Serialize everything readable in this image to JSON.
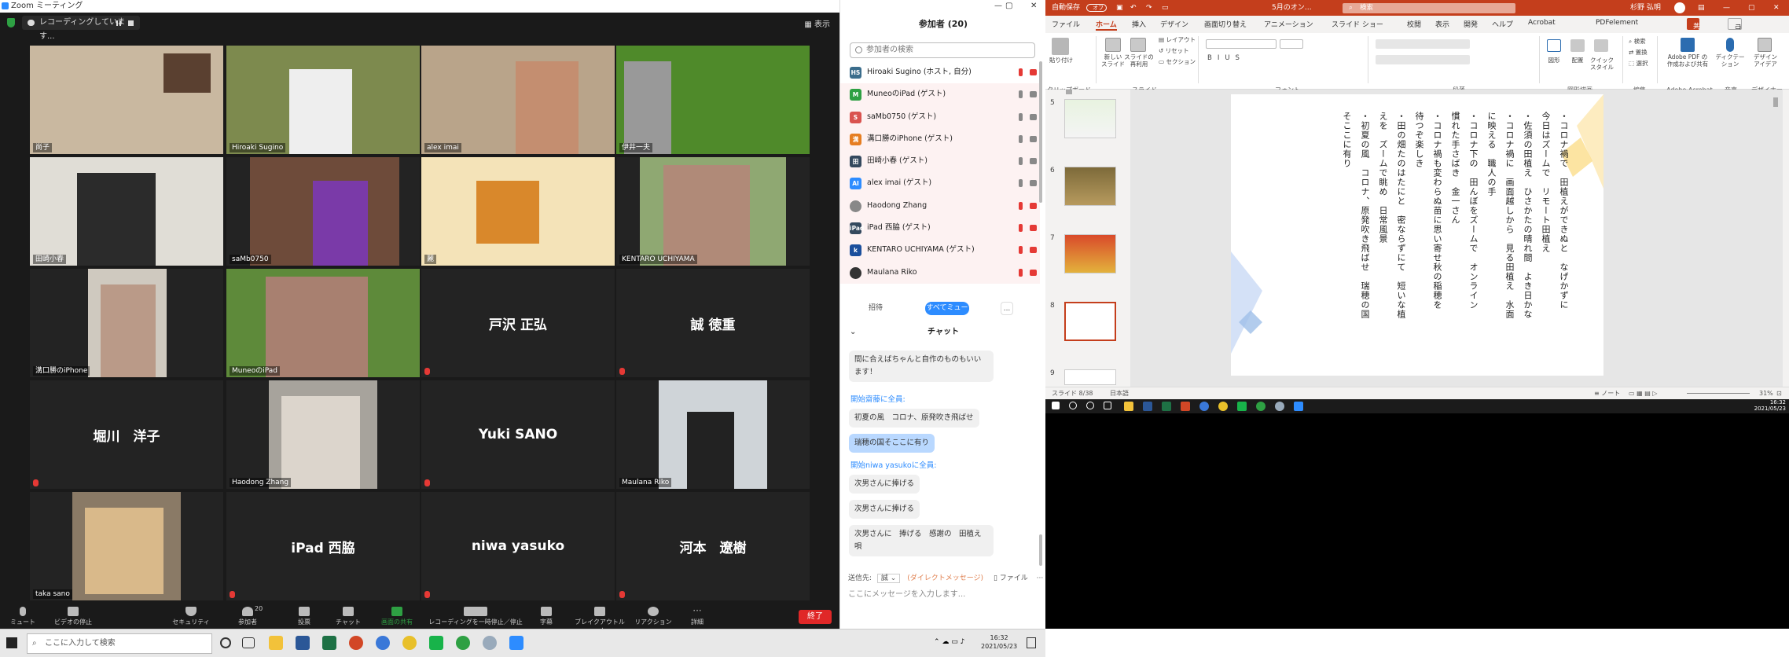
{
  "zoom": {
    "window_title": "Zoom ミーティング",
    "recording_label": "レコーディングしています...",
    "view_label": "表示",
    "tiles": [
      {
        "name": "尚子"
      },
      {
        "name": "Hiroaki Sugino"
      },
      {
        "name": "alex imai"
      },
      {
        "name": "伊井一夫"
      },
      {
        "name": "田崎小春"
      },
      {
        "name": "saMb0750"
      },
      {
        "name": "麗"
      },
      {
        "name": "KENTARO UCHIYAMA"
      },
      {
        "name": "溝口勝のiPhone"
      },
      {
        "name": "MuneoのiPad"
      },
      {
        "center": "戸沢 正弘"
      },
      {
        "center": "誠 徳重"
      },
      {
        "center": "堀川　洋子"
      },
      {
        "name": "Haodong Zhang"
      },
      {
        "center": "Yuki SANO"
      },
      {
        "name": "Maulana Riko"
      },
      {
        "name": "taka sano"
      },
      {
        "center": "iPad 西脇"
      },
      {
        "center": "niwa yasuko"
      },
      {
        "center": "河本　遼樹"
      }
    ],
    "toolbar": {
      "mute": "ミュート",
      "video": "ビデオの停止",
      "security": "セキュリティ",
      "participants": "参加者",
      "participants_count": "20",
      "poll": "投票",
      "chat": "チャット",
      "share": "画面の共有",
      "record": "レコーディングを一時停止／停止",
      "captions": "字幕",
      "breakout": "ブレイクアウトルーム",
      "reactions": "リアクション",
      "more": "詳細",
      "end": "終了"
    }
  },
  "panel": {
    "title": "参加者 (20)",
    "search_placeholder": "参加者の検索",
    "participants": [
      {
        "initials": "HS",
        "name": "Hiroaki Sugino (ホスト, 自分)",
        "color": "#3a6d8c"
      },
      {
        "initials": "M",
        "name": "MuneoのiPad (ゲスト)",
        "color": "#2ea043"
      },
      {
        "initials": "S",
        "name": "saMb0750 (ゲスト)",
        "color": "#d9534f"
      },
      {
        "initials": "溝",
        "name": "溝口勝のiPhone (ゲスト)",
        "color": "#e67e22"
      },
      {
        "initials": "田",
        "name": "田崎小春 (ゲスト)",
        "color": "#34495e"
      },
      {
        "initials": "AI",
        "name": "alex imai (ゲスト)",
        "color": "#2d8cff"
      },
      {
        "initials": "",
        "name": "Haodong Zhang",
        "color": "#888"
      },
      {
        "initials": "iPad",
        "name": "iPad 西脇 (ゲスト)",
        "color": "#34495e"
      },
      {
        "initials": "k",
        "name": "KENTARO UCHIYAMA (ゲスト)",
        "color": "#1b4f9c"
      },
      {
        "initials": "",
        "name": "Maulana Riko",
        "color": "#333"
      }
    ],
    "invite": "招待",
    "mute_all": "すべてミュート",
    "more": "...",
    "chat_title": "チャット",
    "messages": {
      "m1": "間に合えばちゃんと自作のものもいいます！",
      "s1_from": "開始",
      "s1_name": "齋藤",
      "s1_to": "に全員:",
      "m2": "初夏の風　コロナ、原発吹き飛ばせ",
      "m3": "瑞穂の国そここに有り",
      "s2_from": "開始",
      "s2_name": "niwa yasuko",
      "s2_to": "に全員:",
      "m4": "次男さんに捧げる",
      "m5": "次男さんに捧げる",
      "m6": "次男さんに　捧げる　感謝の　田植え唄"
    },
    "to_label": "送信先:",
    "to_value": "誠",
    "dm_label": "(ダイレクトメッセージ)",
    "file_label": "ファイル",
    "input_placeholder": "ここにメッセージを入力します..."
  },
  "ppt": {
    "autosave": "自動保存",
    "autosave_state": "オフ",
    "doc_title": "5月のオン…",
    "search": "検索",
    "user": "杉野 弘明",
    "tabs": [
      "ファイル",
      "ホーム",
      "挿入",
      "デザイン",
      "画面切り替え",
      "アニメーション",
      "スライド ショー",
      "校閲",
      "表示",
      "開発",
      "ヘルプ",
      "Acrobat",
      "PDFelement"
    ],
    "share": "共有",
    "comment": "コメント",
    "groups": [
      "クリップボード",
      "スライド",
      "フォント",
      "段落",
      "図形描画",
      "編集",
      "Adobe Acrobat",
      "音声",
      "デザイナー"
    ],
    "btns": {
      "paste": "貼り付け",
      "new_slide": "新しい\nスライド",
      "reuse": "スライドの\n再利用",
      "layout": "レイアウト",
      "reset": "リセット",
      "section": "セクション",
      "shape": "図形",
      "arrange": "配置",
      "quick": "クイック\nスタイル",
      "find": "検索",
      "replace": "置換",
      "select": "選択",
      "adobe": "Adobe PDF の\n作成および共有",
      "dictate": "ディクテー\nション",
      "designer": "デザイン\nアイデア"
    },
    "slide_nums": [
      "5",
      "6",
      "7",
      "8",
      "9"
    ],
    "slide_lines": [
      "・コロナ禍で　田植えができぬと　なげかずに",
      "今日はズームで　リモート田植え",
      "・佐須の田植え　ひさかたの晴れ間　よき日かな",
      "・コロナ禍に　画面越しから　見る田植え　水面",
      "に映える　職人の手",
      "・コロナ下の　田んぼをズームで　オンライン",
      "慣れた手さばき　金一さん",
      "・コロナ禍も変わらぬ苗に思い寄せ秋の稲穂を",
      "待つぞ楽しき",
      "・田の畑たのはたにと　密ならずにて　短いな植",
      "えを　ズームで眺め　日常風景",
      "・初夏の風　コロナ、原発吹き飛ばせ　瑞穂の国",
      "そここに有り"
    ],
    "status_slide": "スライド 8/38",
    "status_lang": "日本語",
    "status_note": "ノート",
    "zoom_pct": "31%"
  },
  "desktop": {
    "clock_time": "16:32",
    "clock_date": "2021/05/23"
  },
  "taskbar": {
    "search": "ここに入力して検索",
    "time": "16:32",
    "date": "2021/05/23"
  }
}
